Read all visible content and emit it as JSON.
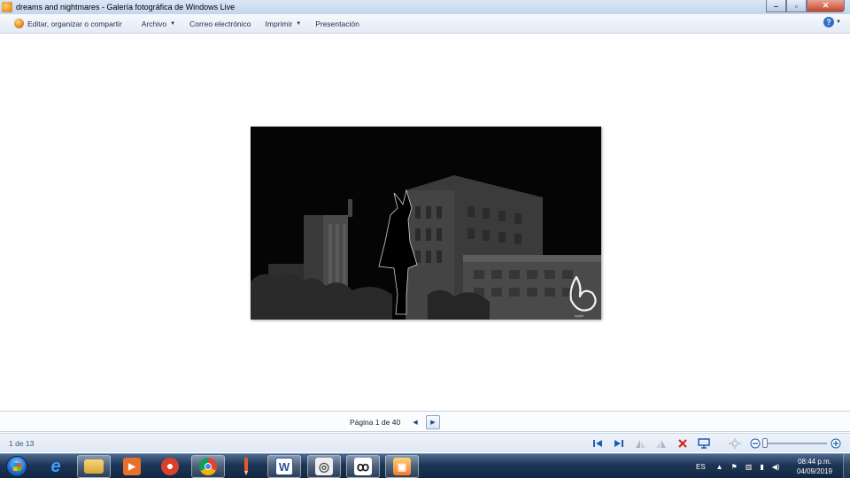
{
  "window": {
    "title": "dreams and nightmares - Galería fotográfica de Windows Live",
    "controls": {
      "minimize": "‒",
      "maximize": "▫",
      "close": "✕"
    }
  },
  "commandbar": {
    "edit_label": "Editar, organizar o compartir",
    "archivo_label": "Archivo",
    "correo_label": "Correo electrónico",
    "imprimir_label": "Imprimir",
    "presentacion_label": "Presentación",
    "help_glyph": "?",
    "caret": "▼"
  },
  "photo": {
    "signature": "Apple"
  },
  "pagebar": {
    "page_text": "Página 1 de 40",
    "prev_glyph": "◀",
    "next_glyph": "▶"
  },
  "statusbar": {
    "count_text": "1 de 13",
    "icons": [
      "previous-icon",
      "next-icon",
      "rotate-left-icon",
      "rotate-right-icon",
      "delete-icon",
      "slideshow-icon",
      "actual-size-icon",
      "zoom-out-icon",
      "zoom-in-icon"
    ],
    "zoom_level": 0.0
  },
  "taskbar": {
    "apps": [
      {
        "name": "internet-explorer",
        "glyph": "e",
        "color": "#1e88e5"
      },
      {
        "name": "file-explorer",
        "glyph": "",
        "color": "#e9b949"
      },
      {
        "name": "media-player",
        "glyph": "▶",
        "color": "#e7702b"
      },
      {
        "name": "paint-app",
        "glyph": "",
        "color": "#d9412e"
      },
      {
        "name": "chrome",
        "glyph": "",
        "color": "#4285f4"
      },
      {
        "name": "pencil-app",
        "glyph": "",
        "color": "#d9412e"
      },
      {
        "name": "word",
        "glyph": "W",
        "color": "#2b579a"
      },
      {
        "name": "spiral-app",
        "glyph": "◎",
        "color": "#555555"
      },
      {
        "name": "clip-studio",
        "glyph": "ꝏ",
        "color": "#333333"
      },
      {
        "name": "photo-gallery",
        "glyph": "▣",
        "color": "#f07b2b"
      }
    ],
    "tray": {
      "language": "ES",
      "expand_glyph": "▲",
      "flag_glyph": "⚑",
      "network_glyph": "▥",
      "signal_glyph": "▮",
      "volume_glyph": "◀)"
    },
    "clock": {
      "time": "08:44 p.m.",
      "date": "04/09/2019"
    }
  },
  "colors": {
    "titlebar": "#c3d6ee",
    "taskbar": "#1d3556",
    "photo_bg": "#050505"
  }
}
